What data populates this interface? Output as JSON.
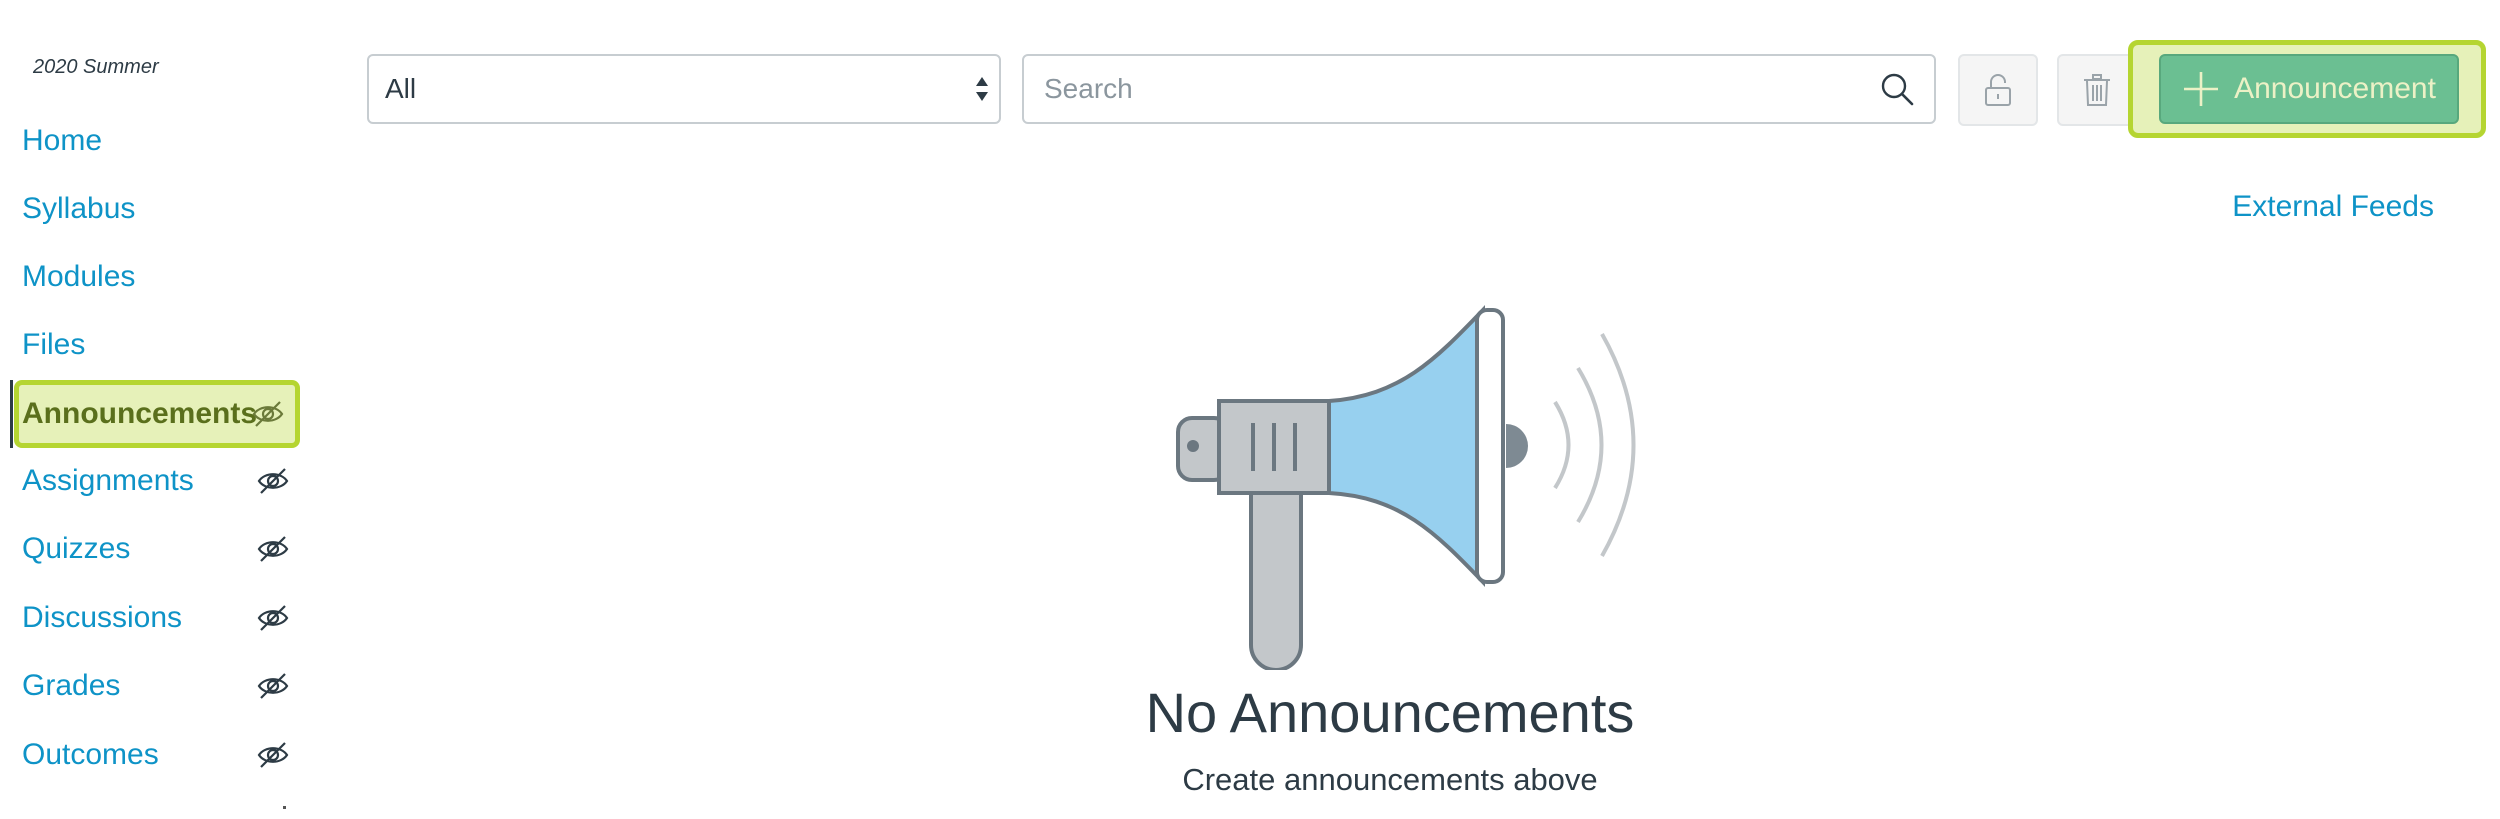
{
  "sidebar": {
    "term": "2020 Summer",
    "items": [
      {
        "label": "Home"
      },
      {
        "label": "Syllabus"
      },
      {
        "label": "Modules"
      },
      {
        "label": "Files"
      },
      {
        "label": "Announcements",
        "active": true,
        "hidden_icon": "eye-slash-icon"
      },
      {
        "label": "Assignments",
        "hidden_icon": "eye-slash-icon"
      },
      {
        "label": "Quizzes",
        "hidden_icon": "eye-slash-icon"
      },
      {
        "label": "Discussions",
        "hidden_icon": "eye-slash-icon"
      },
      {
        "label": "Grades",
        "hidden_icon": "eye-slash-icon"
      },
      {
        "label": "Outcomes",
        "hidden_icon": "eye-slash-icon"
      }
    ]
  },
  "toolbar": {
    "filter_value": "All",
    "search_placeholder": "Search",
    "add_label": "Announcement",
    "lock_icon": "unlock-icon",
    "delete_icon": "trash-icon"
  },
  "external_feeds_label": "External Feeds",
  "empty_state": {
    "title": "No Announcements",
    "subtitle": "Create announcements above",
    "icon": "megaphone-icon"
  },
  "colors": {
    "link": "#0e93c7",
    "highlight_border": "#b5d531",
    "highlight_fill": "#e6f1b9",
    "primary_button": "#6bbf92",
    "text": "#2d3b45"
  }
}
